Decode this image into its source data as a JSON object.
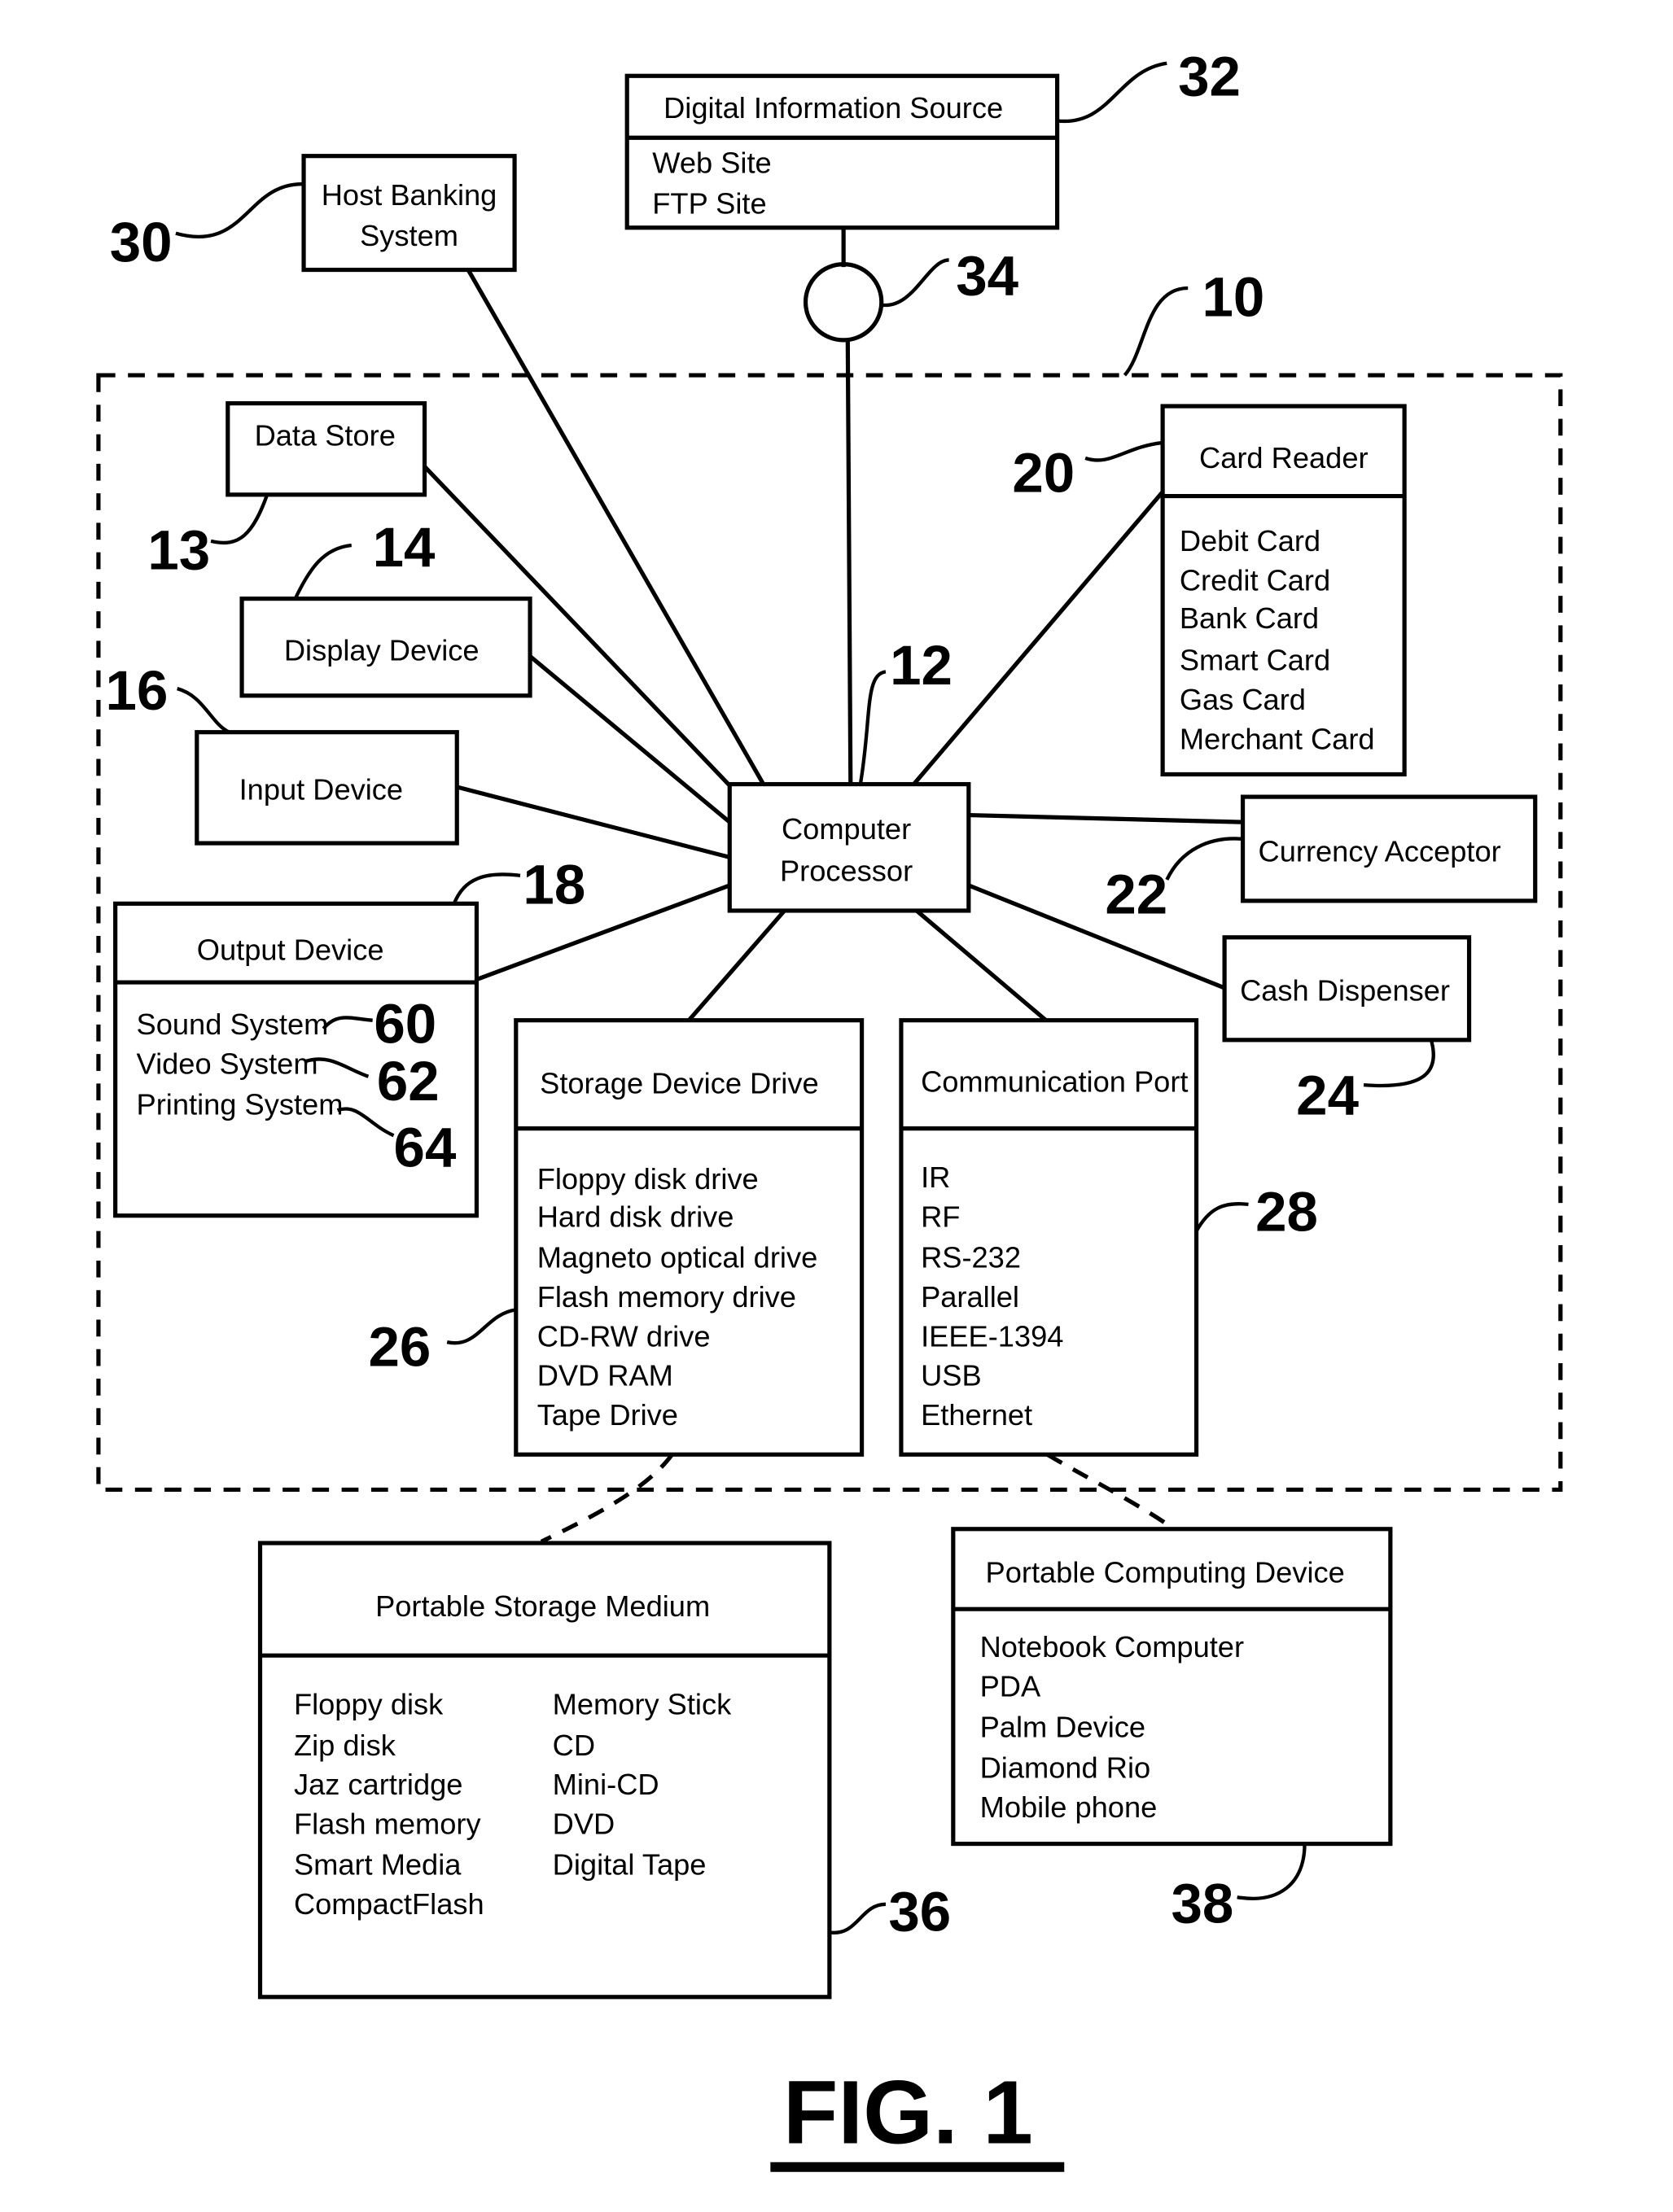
{
  "figure_label": "FIG. 1",
  "nodes": {
    "digital_source": {
      "ref": "32",
      "title": "Digital Information Source",
      "items": [
        "Web Site",
        "FTP Site"
      ]
    },
    "network": {
      "ref": "34"
    },
    "system": {
      "ref": "10"
    },
    "host_banking": {
      "ref": "30",
      "line1": "Host Banking",
      "line2": "System"
    },
    "data_store": {
      "ref": "13",
      "title": "Data Store"
    },
    "display_device": {
      "ref": "14",
      "title": "Display Device"
    },
    "input_device": {
      "ref": "16",
      "title": "Input Device"
    },
    "output_device": {
      "ref": "18",
      "title": "Output Device",
      "items": [
        {
          "label": "Sound System",
          "ref": "60"
        },
        {
          "label": "Video System",
          "ref": "62"
        },
        {
          "label": "Printing System",
          "ref": "64"
        }
      ]
    },
    "processor": {
      "ref": "12",
      "line1": "Computer",
      "line2": "Processor"
    },
    "card_reader": {
      "ref": "20",
      "title": "Card Reader",
      "items": [
        "Debit Card",
        "Credit Card",
        "Bank Card",
        "Smart Card",
        "Gas Card",
        "Merchant Card"
      ]
    },
    "currency_acceptor": {
      "ref": "22",
      "title": "Currency Acceptor"
    },
    "cash_dispenser": {
      "ref": "24",
      "title": "Cash Dispenser"
    },
    "storage_drive": {
      "ref": "26",
      "title": "Storage  Device Drive",
      "items": [
        "Floppy disk drive",
        "Hard disk drive",
        "Magneto optical drive",
        "Flash memory drive",
        "CD-RW drive",
        "DVD RAM",
        "Tape Drive"
      ]
    },
    "comm_port": {
      "ref": "28",
      "title": "Communication Port",
      "items": [
        "IR",
        "RF",
        "RS-232",
        "Parallel",
        "IEEE-1394",
        "USB",
        "Ethernet"
      ]
    },
    "portable_storage": {
      "ref": "36",
      "title": "Portable Storage Medium",
      "col1": [
        "Floppy disk",
        "Zip disk",
        "Jaz cartridge",
        "Flash memory",
        "Smart Media",
        "CompactFlash"
      ],
      "col2": [
        "Memory Stick",
        "CD",
        "Mini-CD",
        "DVD",
        "Digital Tape"
      ]
    },
    "portable_computing": {
      "ref": "38",
      "title": "Portable Computing Device",
      "items": [
        "Notebook Computer",
        "PDA",
        "Palm Device",
        "Diamond Rio",
        "Mobile phone"
      ]
    }
  }
}
